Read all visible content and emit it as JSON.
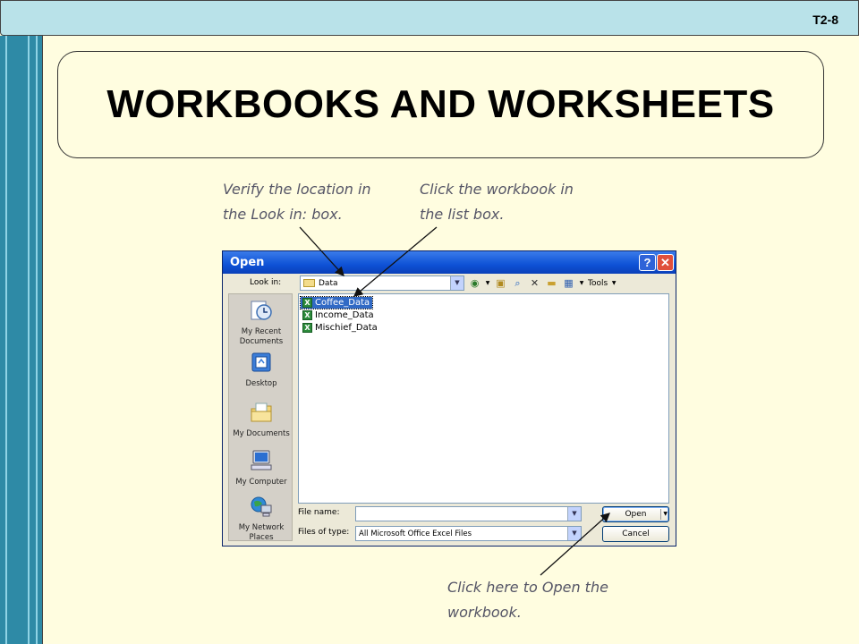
{
  "slide": {
    "number": "T2-8",
    "title": "WORKBOOKS AND WORKSHEETS"
  },
  "callouts": {
    "lookin_line1": "Verify the location in",
    "lookin_line2": "the Look in: box.",
    "workbook_line1": "Click the workbook in",
    "workbook_line2": "the list box.",
    "open_line1": "Click here to Open the",
    "open_line2": "workbook."
  },
  "dialog": {
    "title": "Open",
    "help_glyph": "?",
    "close_glyph": "✕",
    "look_in_label": "Look in:",
    "look_in_value": "Data",
    "tools_label": "Tools",
    "places": [
      {
        "label_1": "My Recent",
        "label_2": "Documents",
        "icon": "recent-documents-icon"
      },
      {
        "label_1": "Desktop",
        "label_2": "",
        "icon": "desktop-icon"
      },
      {
        "label_1": "My Documents",
        "label_2": "",
        "icon": "my-documents-icon"
      },
      {
        "label_1": "My Computer",
        "label_2": "",
        "icon": "my-computer-icon"
      },
      {
        "label_1": "My Network",
        "label_2": "Places",
        "icon": "network-places-icon"
      }
    ],
    "files": [
      {
        "name": "Coffee_Data",
        "selected": true
      },
      {
        "name": "Income_Data",
        "selected": false
      },
      {
        "name": "Mischief_Data",
        "selected": false
      }
    ],
    "file_name_label": "File name:",
    "file_name_value": "",
    "files_of_type_label": "Files of type:",
    "files_of_type_value": "All Microsoft Office Excel Files",
    "open_button": "Open",
    "cancel_button": "Cancel"
  },
  "colors": {
    "background": "#fffde0",
    "top_bar": "#b9e2e9",
    "left_bar": "#2e8aa6",
    "title_bar": "#0e52d6",
    "selection": "#316ac5"
  }
}
